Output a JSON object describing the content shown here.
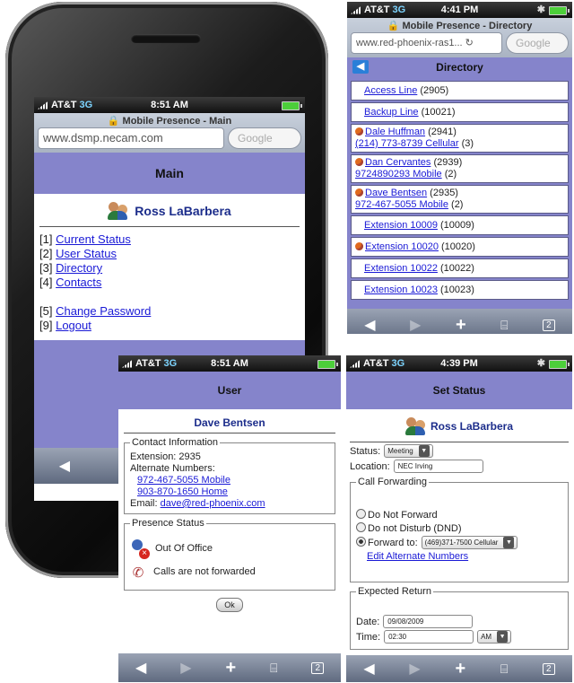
{
  "carrier": "AT&T",
  "network": "3G",
  "main": {
    "time": "8:51 AM",
    "page_title": "Mobile Presence - Main",
    "url": "www.dsmp.necam.com",
    "search_placeholder": "Google",
    "header": "Main",
    "user_name": "Ross LaBarbera",
    "menu": [
      {
        "num": "[1]",
        "label": "Current Status"
      },
      {
        "num": "[2]",
        "label": "User Status"
      },
      {
        "num": "[3]",
        "label": "Directory"
      },
      {
        "num": "[4]",
        "label": "Contacts"
      },
      {
        "num": "[5]",
        "label": "Change Password"
      },
      {
        "num": "[9]",
        "label": "Logout"
      }
    ]
  },
  "directory": {
    "time": "4:41 PM",
    "page_title": "Mobile Presence - Directory",
    "url": "www.red-phoenix-ras1...",
    "search_placeholder": "Google",
    "header": "Directory",
    "items": [
      {
        "name": "Access Line",
        "ext": "(2905)"
      },
      {
        "name": "Backup Line",
        "ext": "(10021)"
      },
      {
        "name": "Dale Huffman",
        "ext": "(2941)",
        "sub_link": "(214) 773-8739 Cellular",
        "sub_count": "(3)"
      },
      {
        "name": "Dan Cervantes",
        "ext": "(2939)",
        "sub_link": "9724890293 Mobile",
        "sub_count": "(2)"
      },
      {
        "name": "Dave Bentsen",
        "ext": "(2935)",
        "sub_link": "972-467-5055 Mobile",
        "sub_count": "(2)"
      },
      {
        "name": "Extension 10009",
        "ext": "(10009)"
      },
      {
        "name": "Extension 10020",
        "ext": "(10020)"
      },
      {
        "name": "Extension 10022",
        "ext": "(10022)"
      },
      {
        "name": "Extension 10023",
        "ext": "(10023)"
      }
    ]
  },
  "user": {
    "time": "8:51 AM",
    "header": "User",
    "name": "Dave Bentsen",
    "contact_legend": "Contact Information",
    "extension": "Extension:  2935",
    "alt_label": "Alternate Numbers:",
    "alt1": "972-467-5055 Mobile",
    "alt2": "903-870-1650 Home",
    "email_label": "Email:",
    "email": "dave@red-phoenix.com",
    "presence_legend": "Presence Status",
    "presence": "Out Of Office",
    "forwarding": "Calls are not forwarded",
    "ok": "Ok"
  },
  "set_status": {
    "time": "4:39 PM",
    "header": "Set Status",
    "user_name": "Ross LaBarbera",
    "status_label": "Status:",
    "status_value": "Meeting",
    "location_label": "Location:",
    "location_value": "NEC Irving",
    "cf_legend": "Call Forwarding",
    "opt1": "Do Not Forward",
    "opt2": "Do not Disturb (DND)",
    "opt3": "Forward to:",
    "forward_value": "(469)371-7500 Cellular",
    "edit_link": "Edit Alternate Numbers",
    "er_legend": "Expected Return",
    "date_label": "Date:",
    "date_value": "09/08/2009",
    "time_label": "Time:",
    "time_value": "02:30",
    "ampm": "AM"
  },
  "toolbar": {
    "back": "◀",
    "forward": "▶",
    "add": "+",
    "bookmarks": "📖",
    "pages": "2"
  },
  "colors": {
    "title_bar": "#8584cb",
    "link": "#1a1ad6",
    "name": "#1c2d8b"
  }
}
